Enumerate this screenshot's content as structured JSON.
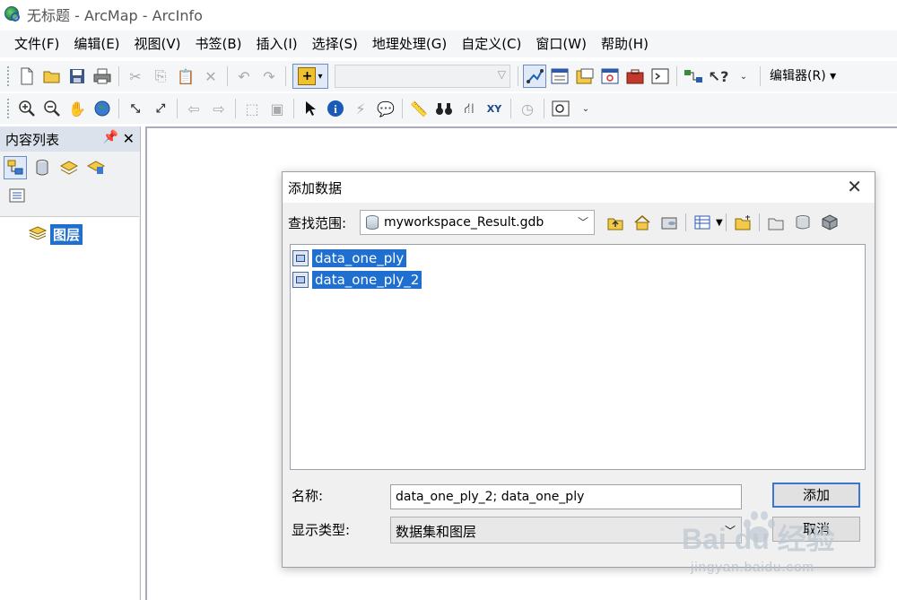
{
  "window": {
    "title": "无标题 - ArcMap - ArcInfo"
  },
  "menu": [
    "文件(F)",
    "编辑(E)",
    "视图(V)",
    "书签(B)",
    "插入(I)",
    "选择(S)",
    "地理处理(G)",
    "自定义(C)",
    "窗口(W)",
    "帮助(H)"
  ],
  "toolbar": {
    "editor_label": "编辑器(R) ▾"
  },
  "toc": {
    "title": "内容列表",
    "layer_label": "图层"
  },
  "dialog": {
    "title": "添加数据",
    "lookin_label": "查找范围:",
    "lookin_value": "myworkspace_Result.gdb",
    "files": [
      {
        "name": "data_one_ply"
      },
      {
        "name": "data_one_ply_2"
      }
    ],
    "name_label": "名称:",
    "name_value": "data_one_ply_2; data_one_ply",
    "type_label": "显示类型:",
    "type_value": "数据集和图层",
    "add_label": "添加",
    "cancel_label": "取消"
  },
  "watermark": {
    "main": "Bai du 经验",
    "sub": "jingyan.baidu.com"
  }
}
